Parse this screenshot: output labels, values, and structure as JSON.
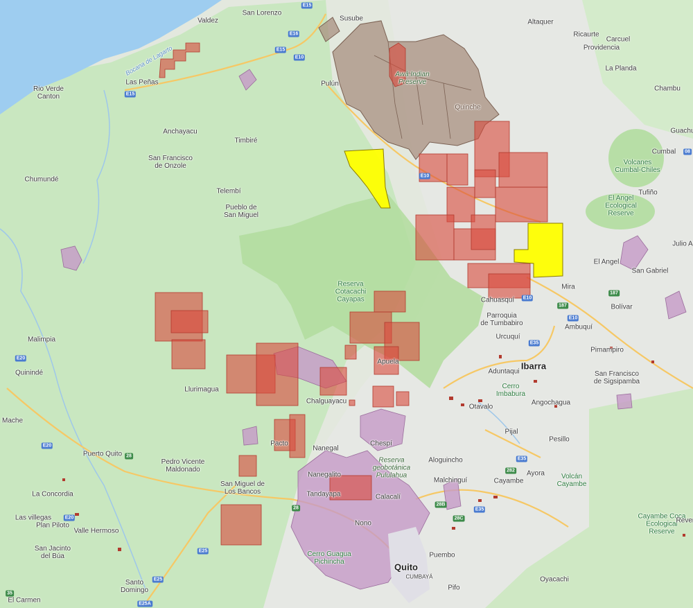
{
  "map": {
    "colors": {
      "land": "#e8ece4",
      "forest": "#c6e6bd",
      "reserve": "#b6dea3",
      "ocean": "#9ecdf0",
      "concession_red": "#d94a3c",
      "concession_yellow": "#ffff00",
      "indigenous_brown": "#a89080",
      "protected_purple": "#c59ac7",
      "road": "#f6c865"
    },
    "labels": {
      "valdez": "Valdez",
      "san_lorenzo": "San Lorenzo",
      "susube": "Susube",
      "altaquer": "Altaquer",
      "ricaurte": "Ricaurte",
      "carcuel": "Carcuel",
      "providencia": "Providencia",
      "la_planda": "La Planda",
      "chambu": "Chambu",
      "guachu": "Guachu",
      "bocana": "Bocana de Lagarto",
      "rio_verde": "Rio Verde\nCanton",
      "las_penas": "Las Peñas",
      "pulun": "Pulún",
      "awa": "Awá Indian\nPreserve",
      "quinche": "Quinche",
      "anchayacu": "Anchayacu",
      "timbire": "Timbiré",
      "san_francisco_onzole": "San Francisco\nde Onzole",
      "chumunde": "Chumundé",
      "telembi": "Telembí",
      "pueblo_san_miguel": "Pueblo de\nSan Miguel",
      "volcanes_cumbal": "Volcanes\nCumbal-Chiles",
      "cumbal": "Cumbal",
      "tufino": "Tufiño",
      "el_angel_reserve": "El Angel\nEcological\nReserve",
      "el_angel": "El Angel",
      "julio": "Julio A",
      "san_gabriel": "San Gabriel",
      "reserva_cotacachi": "Reserva\nCotacachi\nCayapas",
      "mira": "Mira",
      "cahuasqui": "Cahuasquí",
      "bolivar": "Bolívar",
      "parroquia_tumbabiro": "Parroquia\nde Tumbabiro",
      "urcuqui": "Urcuquí",
      "ambuqui": "Ambuquí",
      "malimpia": "Malimpia",
      "apuela": "Apuela",
      "pimampiro": "Pimampiro",
      "quininde": "Quinindé",
      "ibarra": "Ibarra",
      "aduntaqui": "Aduntaqui",
      "san_francisco_sigsipamba": "San Francisco\nde Sigsipamba",
      "llurimagua": "Llurimagua",
      "chalguayacu": "Chalguayacu",
      "cerro_imbabura": "Cerro\nImbabura",
      "angochagua": "Angochagua",
      "mache": "Mache",
      "otavalo": "Otavalo",
      "pacto": "Pacto",
      "chespi": "Chespí",
      "nanegal": "Nanegal",
      "pijal": "Pijal",
      "pesillo": "Pesillo",
      "puerto_quito": "Puerto Quito",
      "pedro_vicente": "Pedro Vicente\nMaldonado",
      "reserva_pululahua": "Reserva\ngeobotánica\nPululahua",
      "aloguincho": "Aloguincho",
      "ayora": "Ayora",
      "volcan_cayambe": "Volcán\nCayambe",
      "malchingui": "Malchinguí",
      "cayambe": "Cayambe",
      "la_concordia": "La Concordia",
      "san_miguel_bancos": "San Miguel de\nLos Bancos",
      "nanegalito": "Nanegalito",
      "tandayapa": "Tandayapa",
      "calacali": "Calacalí",
      "las_villegas": "Las villegas",
      "plan_piloto": "Plan Piloto",
      "valle_hermoso": "Valle Hermoso",
      "nono": "Nono",
      "cayambe_coca": "Cayambe Coca\nEcological\nReserve",
      "reventador": "Reven",
      "san_jacinto": "San Jacinto\ndel Búa",
      "cerro_guagua": "Cerro Guagua\nPichincha",
      "quito": "Quito",
      "cumbaya": "CUMBAYÁ",
      "puembo": "Puembo",
      "santo_domingo": "Santo\nDomingo",
      "pifo": "Pifo",
      "oyacachi": "Oyacachi",
      "el_carmen": "El Carmen"
    },
    "shields": {
      "e15a": "E15",
      "e16": "E16",
      "e15b": "E15",
      "e10a": "E10",
      "e15c": "E15",
      "e10b": "E10",
      "e20a": "E20",
      "e10c": "E10",
      "r187": "187",
      "e35a": "E35",
      "e10d": "E10",
      "r187b": "187",
      "e20b": "E20",
      "r28": "28",
      "e35b": "E35",
      "r28b": "28",
      "e20c": "E20",
      "e25a": "E25",
      "e25b": "E25",
      "r282": "282",
      "r35c": "E35",
      "r28c": "28B",
      "r28d": "28C",
      "e25c": "E25A",
      "r35": "35",
      "r08": "08"
    }
  }
}
